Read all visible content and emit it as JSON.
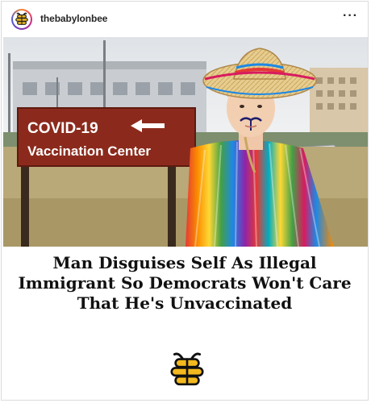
{
  "post": {
    "username": "thebabylonbee",
    "more_label": "···",
    "sign": {
      "line1": "COVID-19",
      "line2": "Vaccination Center"
    },
    "headline": {
      "line1": "Man Disguises Self As Illegal",
      "line2": "Immigrant So Democrats Won't Care",
      "line3": "That He's Unvaccinated"
    }
  },
  "colors": {
    "sign_red": "#8b2a1c",
    "sky": "#e9ecef",
    "ground": "#b8a576",
    "hat": "#e2c88a",
    "accent_yellow": "#f3b91e"
  }
}
